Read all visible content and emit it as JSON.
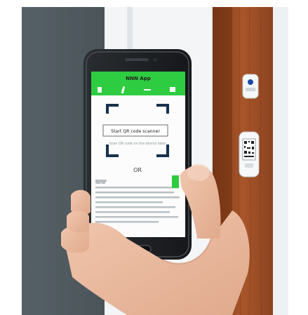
{
  "app": {
    "title": "NNN App",
    "scan_button_label": "Start QR code scanner",
    "instruction_text": "Scan QR code on the device label",
    "or_label": "OR",
    "section_label": "Serial",
    "colors": {
      "accent": "#2ecc40",
      "wood": "#9b4a1f",
      "wall": "#4f5a60"
    }
  }
}
